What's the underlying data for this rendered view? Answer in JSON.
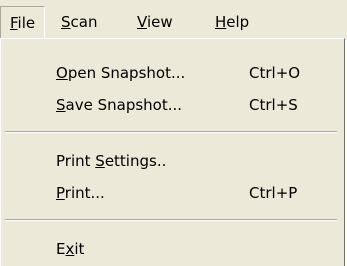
{
  "menubar": {
    "items": [
      {
        "pre": "",
        "mn": "F",
        "post": "ile"
      },
      {
        "pre": "",
        "mn": "S",
        "post": "can"
      },
      {
        "pre": "",
        "mn": "V",
        "post": "iew"
      },
      {
        "pre": "",
        "mn": "H",
        "post": "elp"
      }
    ]
  },
  "menu": {
    "items": [
      {
        "pre": "",
        "mn": "O",
        "post": "pen Snapshot...",
        "shortcut": "Ctrl+O"
      },
      {
        "pre": "",
        "mn": "S",
        "post": "ave Snapshot...",
        "shortcut": "Ctrl+S"
      },
      {
        "pre": "Print ",
        "mn": "S",
        "post": "ettings..",
        "shortcut": ""
      },
      {
        "pre": "",
        "mn": "P",
        "post": "rint...",
        "shortcut": "Ctrl+P"
      },
      {
        "pre": "E",
        "mn": "x",
        "post": "it",
        "shortcut": ""
      }
    ]
  }
}
